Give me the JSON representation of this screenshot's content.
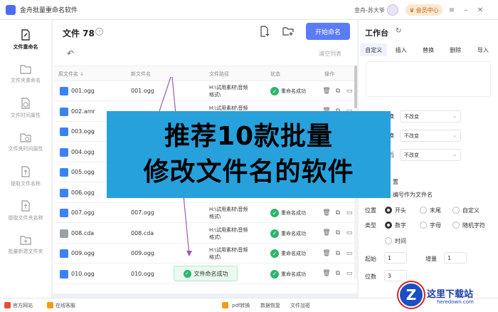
{
  "app": {
    "title": "金舟批量重命名软件",
    "user": "金舟-苏大爷",
    "vip_label": "会员中心"
  },
  "sidebar": {
    "items": [
      {
        "label": "文件重命名",
        "icon": "file-rename-icon"
      },
      {
        "label": "文件夹重命名",
        "icon": "folder-rename-icon"
      },
      {
        "label": "文件时间属性",
        "icon": "file-time-icon"
      },
      {
        "label": "文件夹时间属性",
        "icon": "folder-time-icon"
      },
      {
        "label": "提取文件名称",
        "icon": "extract-file-name-icon"
      },
      {
        "label": "提取文件夹名称",
        "icon": "extract-folder-name-icon"
      },
      {
        "label": "批量新建文件夹",
        "icon": "batch-new-folder-icon"
      }
    ]
  },
  "main": {
    "files_title": "文件 78",
    "help": "?",
    "start_label": "开始命名",
    "clear_label": "清空列表",
    "columns": [
      "原文件名 ↓",
      "新文件名",
      "文件路径",
      "状态",
      "操作"
    ],
    "rows": [
      {
        "orig": "001.ogg",
        "new": "001.ogg",
        "path1": "H:\\试用素材\\音频",
        "path2": "格式\\",
        "status": "重命名成功",
        "type": "ogg"
      },
      {
        "orig": "002.amr",
        "new": "",
        "path1": "H:\\试用素材\\音频",
        "path2": "",
        "status": "",
        "type": "amr"
      },
      {
        "orig": "003.ogg",
        "new": "",
        "path1": "",
        "path2": "",
        "status": "",
        "type": "ogg"
      },
      {
        "orig": "004.ogg",
        "new": "",
        "path1": "",
        "path2": "",
        "status": "",
        "type": "ogg"
      },
      {
        "orig": "005.ogg",
        "new": "",
        "path1": "",
        "path2": "",
        "status": "",
        "type": "ogg"
      },
      {
        "orig": "006.ogg",
        "new": "",
        "path1": "",
        "path2": "",
        "status": "",
        "type": "ogg"
      },
      {
        "orig": "007.ogg",
        "new": "007.ogg",
        "path1": "H:\\试用素材\\音频",
        "path2": "格式\\",
        "status": "重命名成功",
        "type": "ogg"
      },
      {
        "orig": "008.cda",
        "new": "008.cda",
        "path1": "H:\\试用素材\\音频",
        "path2": "格式\\",
        "status": "重命名成功",
        "type": "cda"
      },
      {
        "orig": "009.ogg",
        "new": "009.ogg",
        "path1": "H:\\试用素材\\音频",
        "path2": "格式\\",
        "status": "重命名成功",
        "type": "ogg"
      },
      {
        "orig": "010.ogg",
        "new": "010.ogg",
        "path1": "",
        "path2": "",
        "status": "重命名成功",
        "type": "ogg"
      }
    ],
    "toast": "文件命名成功"
  },
  "workspace": {
    "title": "工作台",
    "tabs": [
      "自定义",
      "插入",
      "替换",
      "删除",
      "导入"
    ],
    "selects": [
      {
        "label": "换",
        "value": "不改变"
      },
      {
        "label": "换",
        "value": "不改变"
      },
      {
        "label": "后",
        "value": "不改变"
      }
    ],
    "section": "置",
    "section_note": "编号作为文件名",
    "position_label": "位置",
    "position_options": [
      "开头",
      "末尾",
      "自定义"
    ],
    "type_label": "类型",
    "type_options": [
      "数字",
      "字母",
      "随机字符",
      "时间"
    ],
    "start_label": "起始",
    "start_value": "1",
    "step_label": "增量",
    "step_value": "1",
    "digits_label": "位数",
    "digits_value": "3"
  },
  "footer": {
    "items": [
      "官方网站",
      "在线客服",
      "pdf转换",
      "数据恢复",
      "文件加密"
    ]
  },
  "banner": {
    "line1": "推荐10款批量",
    "line2": "修改文件名的软件"
  },
  "watermark": {
    "logo": "Z",
    "text": "这里下载站",
    "url": "heredown.com"
  },
  "colors": {
    "accent": "#5b7cfa",
    "success": "#2cb56b",
    "banner": "#27a1dc"
  }
}
